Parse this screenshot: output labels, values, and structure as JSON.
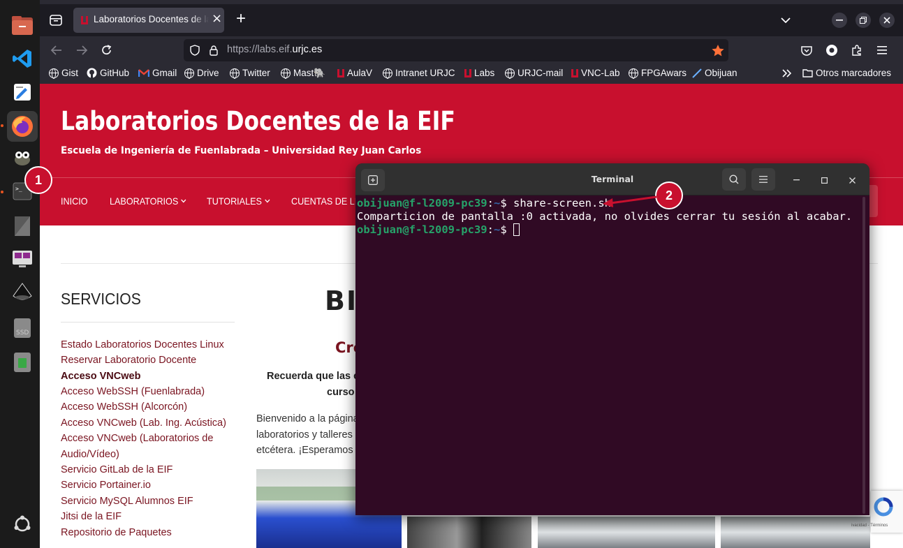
{
  "browser": {
    "tab": {
      "title": "Laboratorios Docentes de la EIF",
      "close": "×"
    },
    "new_tab": "+",
    "url": {
      "prefix": "https://labs.eif.",
      "domain": "urjc.es"
    },
    "bookmarks": [
      {
        "label": "Gist",
        "icon": "globe-icon"
      },
      {
        "label": "GitHub",
        "icon": "github-icon"
      },
      {
        "label": "Gmail",
        "icon": "gmail-icon"
      },
      {
        "label": "Drive",
        "icon": "globe-icon"
      },
      {
        "label": "Twitter",
        "icon": "globe-icon"
      },
      {
        "label": "Mast🐘",
        "icon": "globe-icon"
      },
      {
        "label": "AulaV",
        "icon": "urjc-icon"
      },
      {
        "label": "Intranet URJC",
        "icon": "globe-icon"
      },
      {
        "label": "Labs",
        "icon": "urjc-icon"
      },
      {
        "label": "URJC-mail",
        "icon": "globe-icon"
      },
      {
        "label": "VNC-Lab",
        "icon": "urjc-icon"
      },
      {
        "label": "FPGAwars",
        "icon": "globe-icon"
      },
      {
        "label": "Obijuan",
        "icon": "pen-icon"
      }
    ],
    "other_bookmarks": "Otros marcadores"
  },
  "site": {
    "title": "Laboratorios Docentes de la EIF",
    "subtitle": "Escuela de Ingeniería de Fuenlabrada – Universidad Rey Juan Carlos",
    "nav": [
      "INICIO",
      "LABORATORIOS",
      "TUTORIALES",
      "CUENTAS DE LIN"
    ],
    "services_heading": "SERVICIOS",
    "services": [
      "Estado Laboratorios Docentes Linux",
      "Reservar Laboratorio Docente",
      "Acceso VNCweb",
      "Acceso WebSSH (Fuenlabrada)",
      "Acceso WebSSH (Alcorcón)",
      "Acceso VNCweb (Lab. Ing. Acústica)",
      "Acceso VNCweb (Laboratorios de",
      "Audio/Vídeo)",
      "Servicio GitLab de la EIF",
      "Servicio Portainer.io",
      "Servicio MySQL Alumnos EIF",
      "Jitsi de la EIF",
      "Repositorio de Paquetes"
    ],
    "main_heading": "BI",
    "subheading": "Cre",
    "notice_line1": "Recuerda que las c",
    "notice_line2": "curso",
    "body_lines": [
      "Bienvenido a la página",
      "laboratorios y talleres",
      "etcétera. ¡Esperamos c"
    ],
    "recaptcha_text": "ivacidad - Términos"
  },
  "terminal": {
    "title": "Terminal",
    "prompt_user": "obijuan@f-l2009-pc39",
    "prompt_sep": ":",
    "prompt_path": "~",
    "prompt_sign": "$ ",
    "command": "share-screen.sh",
    "output": "Comparticion de pantalla :0 activada, no olvides cerrar tu sesión al acabar."
  },
  "annotations": {
    "badge1": "1",
    "badge2": "2"
  },
  "colors": {
    "site_red": "#c8102e",
    "terminal_bg": "#300a24",
    "prompt_green": "#26a269",
    "path_blue": "#3465a4",
    "link": "#7a1420"
  }
}
